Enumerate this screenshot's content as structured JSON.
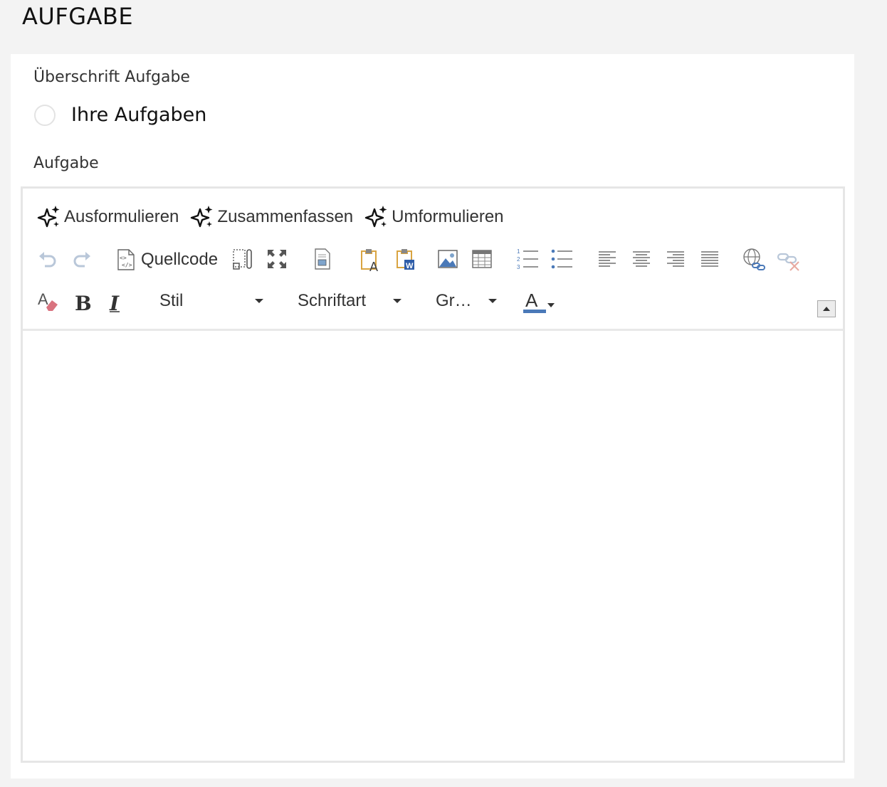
{
  "page": {
    "title": "AUFGABE"
  },
  "heading_field": {
    "label": "Überschrift Aufgabe",
    "option_label": "Ihre Aufgaben"
  },
  "task_field": {
    "label": "Aufgabe"
  },
  "ai_tools": {
    "formulate": "Ausformulieren",
    "summarize": "Zusammenfassen",
    "rephrase": "Umformulieren"
  },
  "toolbar": {
    "source_label": "Quellcode",
    "style_label": "Stil",
    "font_label": "Schriftart",
    "size_label": "Gr…",
    "colors": {
      "accent": "#4a79b8",
      "paste": "#d9a441",
      "eraser": "#d9737f",
      "disabled": "#b9c7d9"
    }
  }
}
